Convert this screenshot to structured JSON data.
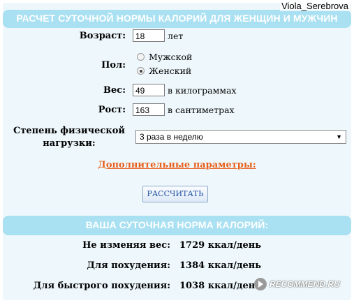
{
  "watermark_user": "Viola_Serebrova",
  "form": {
    "header": "РАСЧЕТ СУТОЧНОЙ НОРМЫ КАЛОРИЙ ДЛЯ ЖЕНЩИН И МУЖЧИН",
    "age": {
      "label": "Возраст:",
      "value": "18",
      "unit": "лет"
    },
    "sex": {
      "label": "Пол:",
      "options": [
        {
          "label": "Мужской",
          "checked": false
        },
        {
          "label": "Женский",
          "checked": true
        }
      ]
    },
    "weight": {
      "label": "Вес:",
      "value": "49",
      "unit": "в килограммах"
    },
    "height": {
      "label": "Рост:",
      "value": "163",
      "unit": "в сантиметрах"
    },
    "activity": {
      "label_line1": "Степень физической",
      "label_line2": "нагрузки:",
      "selected": "3 раза в неделю"
    },
    "extra_link": "Дополнительные параметры:",
    "calc_button": "РАССЧИТАТЬ"
  },
  "results": {
    "header": "ВАША СУТОЧНАЯ НОРМА КАЛОРИЙ:",
    "rows": [
      {
        "label": "Не изменяя вес:",
        "value": "1729 ккал/день"
      },
      {
        "label": "Для похудения:",
        "value": "1384 ккал/день"
      },
      {
        "label": "Для быстрого похудения:",
        "value": "1038 ккал/день"
      }
    ]
  },
  "watermark_site": "RECOMMEND.RU",
  "colors": {
    "header_bg": "#a9e0f2",
    "panel_bg": "#eef8fc",
    "link": "#e8601c",
    "button_text": "#2050a0"
  }
}
